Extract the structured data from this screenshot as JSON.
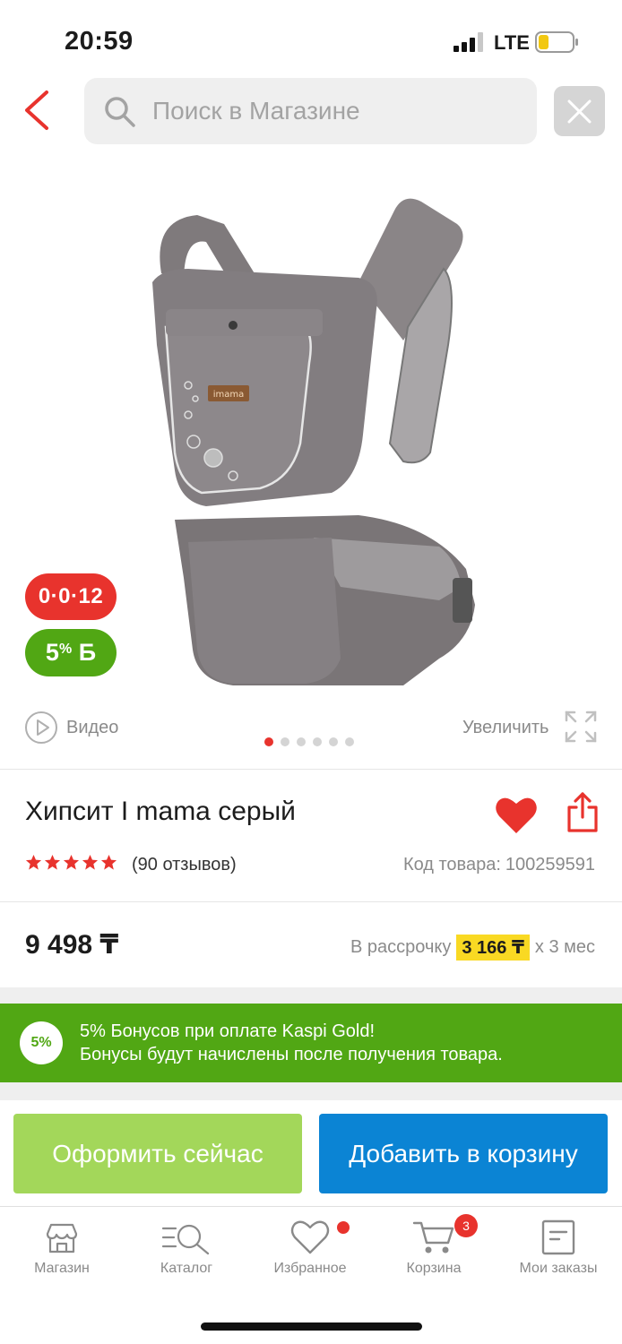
{
  "status_bar": {
    "time": "20:59",
    "network": "LTE"
  },
  "search": {
    "placeholder": "Поиск в Магазине"
  },
  "gallery": {
    "installment_badge": "0·0·12",
    "bonus_badge_percent": "5",
    "bonus_badge_sup": "%",
    "bonus_badge_symbol": "Б",
    "video_label": "Видео",
    "zoom_label": "Увеличить",
    "image_count": 6,
    "active_image": 1,
    "product_logo_text": "imama"
  },
  "product": {
    "title": "Хипсит I mama серый",
    "rating_stars": 5,
    "reviews": "(90 отзывов)",
    "sku_label": "Код товара:",
    "sku": "100259591",
    "favorited": true
  },
  "price": {
    "value": "9 498 ₸",
    "installment_prefix": "В рассрочку",
    "installment_amount": "3 166 ₸",
    "installment_suffix": "х 3 мес"
  },
  "bonus_banner": {
    "badge": "5%",
    "line1": "5% Бонусов при оплате Kaspi Gold!",
    "line2": "Бонусы будут начислены после получения товара."
  },
  "actions": {
    "buy_now": "Оформить сейчас",
    "add_to_cart": "Добавить в корзину"
  },
  "tabbar": {
    "items": [
      {
        "label": "Магазин",
        "icon": "shop-icon"
      },
      {
        "label": "Каталог",
        "icon": "catalog-icon"
      },
      {
        "label": "Избранное",
        "icon": "heart-icon"
      },
      {
        "label": "Корзина",
        "icon": "cart-icon"
      },
      {
        "label": "Мои заказы",
        "icon": "orders-icon"
      }
    ],
    "cart_count": "3"
  },
  "colors": {
    "accent_red": "#e8332d",
    "bonus_green": "#51a714",
    "buy_green": "#a3d75a",
    "cart_blue": "#0b84d4",
    "highlight_yellow": "#f9d923"
  }
}
